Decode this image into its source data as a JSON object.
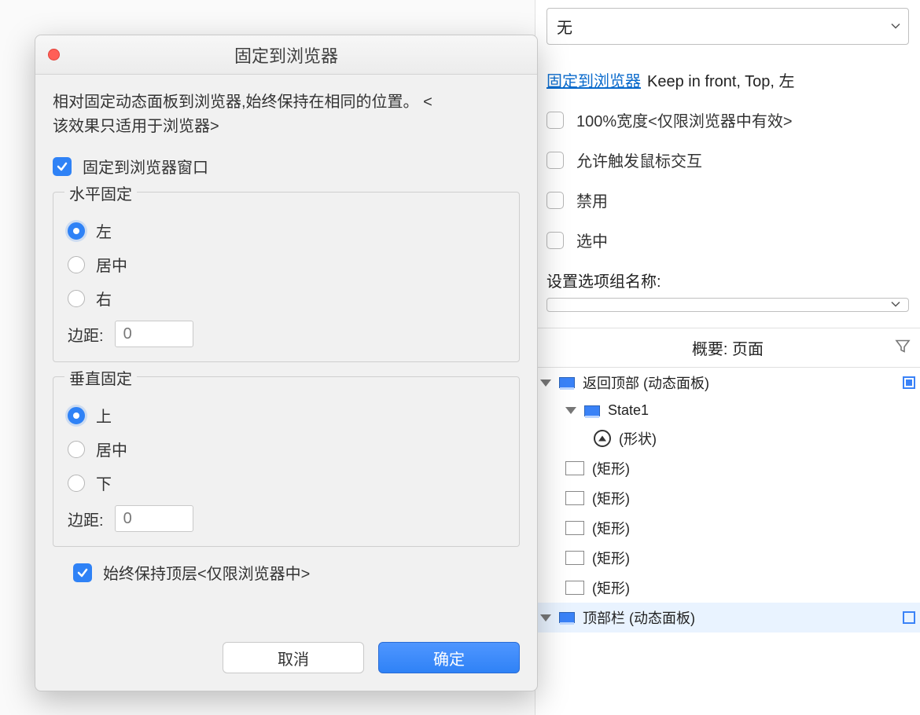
{
  "rightPanel": {
    "scrollSelect": "无",
    "pinLink": "固定到浏览器",
    "pinSummary": "Keep in front, Top, 左",
    "cb100Width": "100%宽度<仅限浏览器中有效>",
    "cbMouseInteractions": "允许触发鼠标交互",
    "cbDisabled": "禁用",
    "cbSelected": "选中",
    "groupNameLabel": "设置选项组名称:",
    "groupNameValue": ""
  },
  "overview": {
    "title": "概要: 页面",
    "items": {
      "backToTop": "返回顶部 (动态面板)",
      "state1": "State1",
      "shape": "(形状)",
      "rect": "(矩形)",
      "topBar": "顶部栏 (动态面板)"
    }
  },
  "modal": {
    "title": "固定到浏览器",
    "description1": "相对固定动态面板到浏览器,始终保持在相同的位置。 <",
    "description2": "该效果只适用于浏览器>",
    "pinCheckbox": "固定到浏览器窗口",
    "horizontal": {
      "legend": "水平固定",
      "left": "左",
      "center": "居中",
      "right": "右",
      "marginLabel": "边距:",
      "marginValue": "0"
    },
    "vertical": {
      "legend": "垂直固定",
      "top": "上",
      "middle": "居中",
      "bottom": "下",
      "marginLabel": "边距:",
      "marginValue": "0"
    },
    "keepFront": "始终保持顶层<仅限浏览器中>",
    "cancel": "取消",
    "ok": "确定"
  }
}
